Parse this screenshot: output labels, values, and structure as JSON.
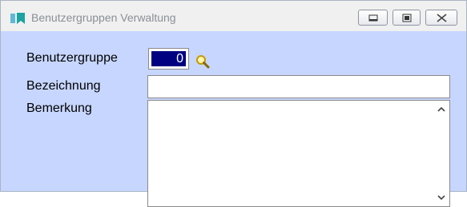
{
  "window": {
    "title": "Benutzergruppen Verwaltung",
    "icon": "bookmark-icon",
    "controls": {
      "minimize_icon": "minimize-icon",
      "maximize_icon": "maximize-icon",
      "close_icon": "close-icon"
    }
  },
  "form": {
    "group_label": "Benutzergruppe",
    "group_value": "0",
    "search_icon": "search-icon",
    "description_label": "Bezeichnung",
    "description_value": "",
    "notes_label": "Bemerkung",
    "notes_value": ""
  },
  "colors": {
    "client_background": "#c7d6ff",
    "selected_field": "#000080",
    "title_icon": "#1aa3a0"
  }
}
